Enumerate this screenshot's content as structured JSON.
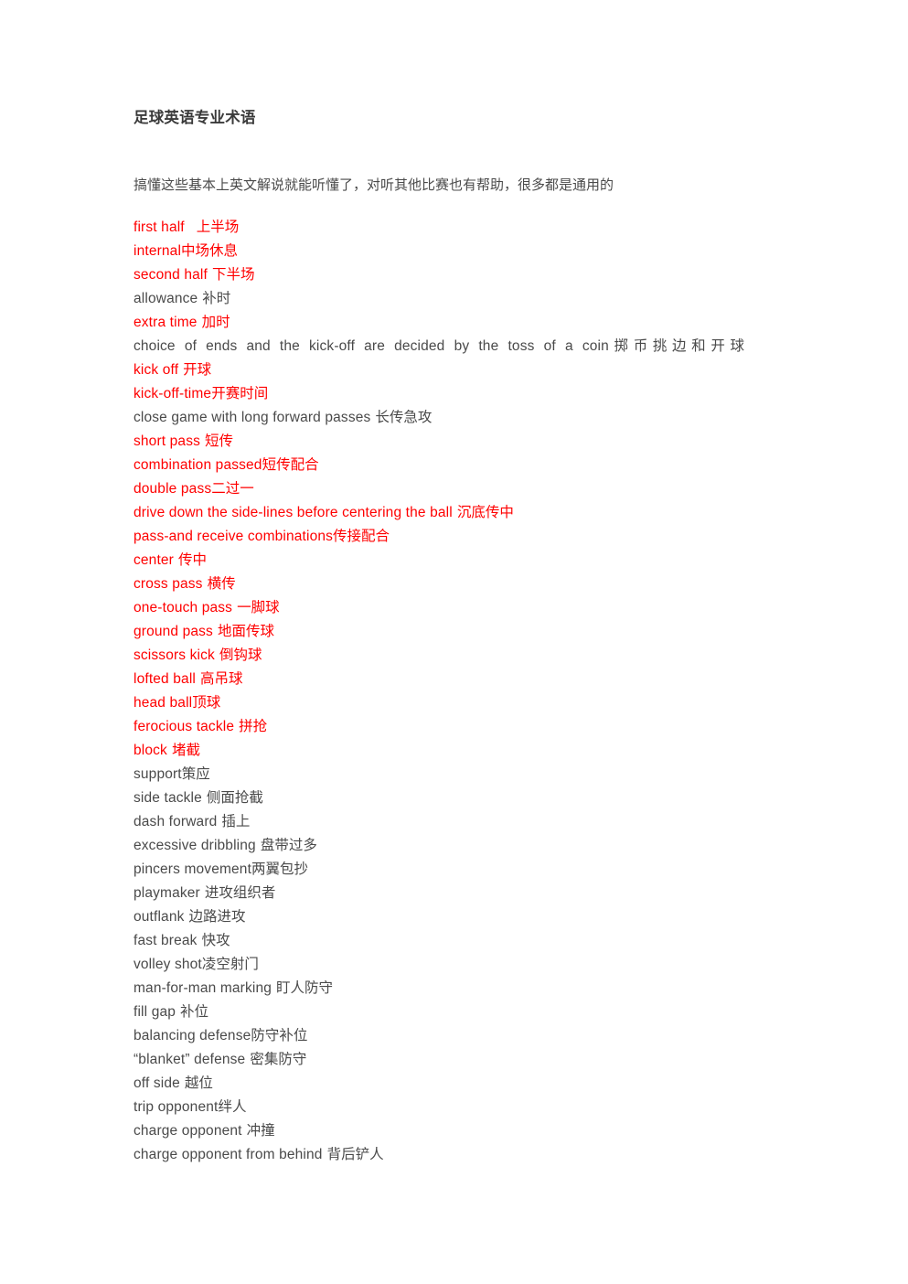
{
  "document": {
    "title": "足球英语专业术语",
    "intro": "搞懂这些基本上英文解说就能听懂了，对听其他比赛也有帮助，很多都是通用的",
    "colors": {
      "red": "#ff0000",
      "body_text": "#4a4a4a",
      "background": "#ffffff"
    },
    "terms": [
      {
        "en": "first half",
        "zh": "上半场",
        "color": "red",
        "gap": "wide",
        "justified": false
      },
      {
        "en": "internal",
        "zh": "中场休息",
        "color": "red",
        "gap": "none",
        "justified": false
      },
      {
        "en": "second half",
        "zh": "下半场",
        "color": "red",
        "gap": "sm",
        "justified": false
      },
      {
        "en": "allowance",
        "zh": "补时",
        "color": "black",
        "gap": "sm",
        "justified": false
      },
      {
        "en": "extra time",
        "zh": "加时",
        "color": "red",
        "gap": "sm",
        "justified": false
      },
      {
        "en": "choice of ends and the kick-off are decided by the toss of a coin",
        "zh": "掷币挑边和开球",
        "color": "black",
        "gap": "none",
        "justified": true
      },
      {
        "en": "kick off",
        "zh": "开球",
        "color": "red",
        "gap": "sm",
        "justified": false
      },
      {
        "en": "kick-off-time",
        "zh": "开赛时间",
        "color": "red",
        "gap": "none",
        "justified": false
      },
      {
        "en": "close game with long forward passes",
        "zh": "长传急攻",
        "color": "black",
        "gap": "sm",
        "justified": false
      },
      {
        "en": "short pass",
        "zh": "短传",
        "color": "red",
        "gap": "sm",
        "justified": false
      },
      {
        "en": "combination passed",
        "zh": "短传配合",
        "color": "red",
        "gap": "none",
        "justified": false
      },
      {
        "en": "double pass",
        "zh": "二过一",
        "color": "red",
        "gap": "none",
        "justified": false
      },
      {
        "en": "drive down the side-lines before centering the ball",
        "zh": "沉底传中",
        "color": "red",
        "gap": "sm",
        "justified": false
      },
      {
        "en": "pass-and receive combinations",
        "zh": "传接配合",
        "color": "red",
        "gap": "none",
        "justified": false
      },
      {
        "en": "center",
        "zh": "传中",
        "color": "red",
        "gap": "sm",
        "justified": false
      },
      {
        "en": "cross pass",
        "zh": "横传",
        "color": "red",
        "gap": "sm",
        "justified": false
      },
      {
        "en": "one-touch pass",
        "zh": "一脚球",
        "color": "red",
        "gap": "sm",
        "justified": false
      },
      {
        "en": "ground pass",
        "zh": "地面传球",
        "color": "red",
        "gap": "sm",
        "justified": false
      },
      {
        "en": "scissors kick",
        "zh": "倒钩球",
        "color": "red",
        "gap": "sm",
        "justified": false
      },
      {
        "en": "lofted ball",
        "zh": "高吊球",
        "color": "red",
        "gap": "sm",
        "justified": false
      },
      {
        "en": "head ball",
        "zh": "顶球",
        "color": "red",
        "gap": "none",
        "justified": false
      },
      {
        "en": "ferocious tackle",
        "zh": "拼抢",
        "color": "red",
        "gap": "sm",
        "justified": false
      },
      {
        "en": "block",
        "zh": "堵截",
        "color": "red",
        "gap": "sm",
        "justified": false
      },
      {
        "en": "support",
        "zh": "策应",
        "color": "black",
        "gap": "none",
        "justified": false
      },
      {
        "en": "side tackle",
        "zh": "侧面抢截",
        "color": "black",
        "gap": "sm",
        "justified": false
      },
      {
        "en": "dash forward",
        "zh": "插上",
        "color": "black",
        "gap": "sm",
        "justified": false
      },
      {
        "en": "excessive dribbling",
        "zh": "盘带过多",
        "color": "black",
        "gap": "sm",
        "justified": false
      },
      {
        "en": "pincers movement",
        "zh": "两翼包抄",
        "color": "black",
        "gap": "none",
        "justified": false
      },
      {
        "en": "playmaker",
        "zh": "进攻组织者",
        "color": "black",
        "gap": "sm",
        "justified": false
      },
      {
        "en": "outflank",
        "zh": "边路进攻",
        "color": "black",
        "gap": "sm",
        "justified": false
      },
      {
        "en": "fast break",
        "zh": "快攻",
        "color": "black",
        "gap": "sm",
        "justified": false
      },
      {
        "en": "volley shot",
        "zh": "凌空射门",
        "color": "black",
        "gap": "none",
        "justified": false
      },
      {
        "en": "man-for-man marking",
        "zh": "盯人防守",
        "color": "black",
        "gap": "sm",
        "justified": false
      },
      {
        "en": "fill gap",
        "zh": "补位",
        "color": "black",
        "gap": "sm",
        "justified": false
      },
      {
        "en": "balancing defense",
        "zh": "防守补位",
        "color": "black",
        "gap": "none",
        "justified": false
      },
      {
        "en": "“blanket” defense",
        "zh": "密集防守",
        "color": "black",
        "gap": "sm",
        "justified": false
      },
      {
        "en": "off side",
        "zh": "越位",
        "color": "black",
        "gap": "sm",
        "justified": false
      },
      {
        "en": "trip opponent",
        "zh": "绊人",
        "color": "black",
        "gap": "none",
        "justified": false
      },
      {
        "en": "charge opponent",
        "zh": "冲撞",
        "color": "black",
        "gap": "sm",
        "justified": false
      },
      {
        "en": "charge opponent from behind",
        "zh": "背后铲人",
        "color": "black",
        "gap": "sm",
        "justified": false
      }
    ]
  }
}
